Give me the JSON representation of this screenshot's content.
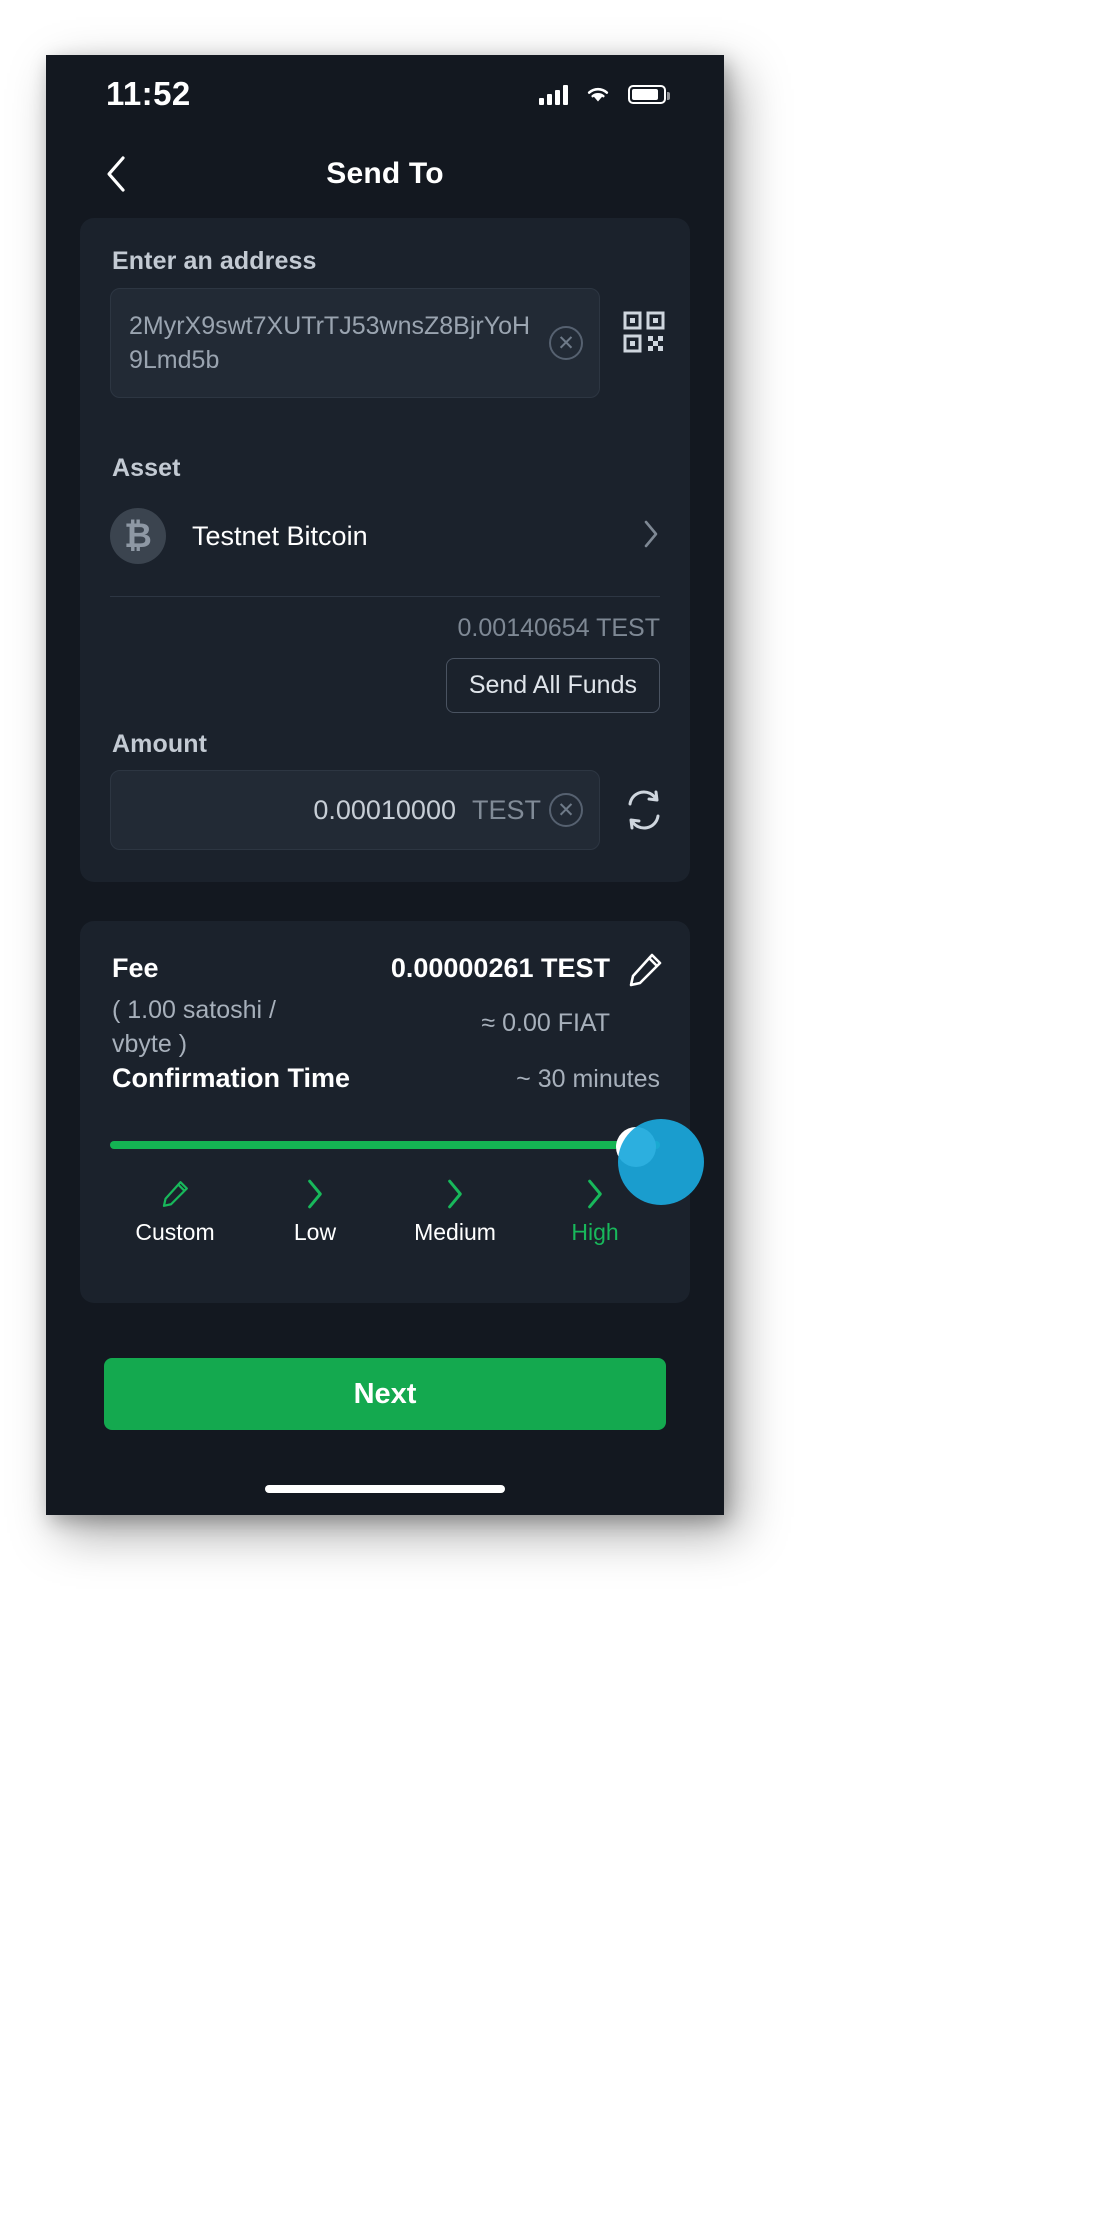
{
  "status_bar": {
    "time": "11:52",
    "signal_icon": "cellular-signal-icon",
    "wifi_icon": "wifi-icon",
    "battery_icon": "battery-icon"
  },
  "header": {
    "title": "Send To",
    "back_icon": "back-chevron-icon"
  },
  "send_card": {
    "address_label": "Enter an address",
    "address_value": "2MyrX9swt7XUTrTJ53wnsZ8BjrYoH9Lmd5b",
    "address_placeholder": "Enter an address",
    "clear_icon": "clear-circle-icon",
    "qr_icon": "qr-code-scan-icon",
    "asset_label": "Asset",
    "asset_symbol": "₿",
    "asset_name": "Testnet Bitcoin",
    "asset_chevron_icon": "chevron-right-icon",
    "balance": "0.00140654 TEST",
    "send_all_label": "Send All Funds",
    "amount_label": "Amount",
    "amount_value": "0.00010000",
    "amount_unit": "TEST",
    "amount_clear_icon": "clear-circle-icon",
    "swap_icon": "swap-currency-icon"
  },
  "fee_card": {
    "fee_label": "Fee",
    "fee_rate": "( 1.00 satoshi / vbyte )",
    "fee_amount": "0.00000261 TEST",
    "fee_fiat": "≈ 0.00 FIAT",
    "edit_icon": "pencil-edit-icon",
    "confirmation_label": "Confirmation Time",
    "confirmation_value": "~ 30 minutes",
    "slider": {
      "selected": "High",
      "position_percent": 100,
      "track_color": "#14b453",
      "thumb_color": "#ffffff",
      "ripple_color": "#1aa8dc"
    },
    "steps": [
      {
        "label": "Custom",
        "icon": "pencil-edit-icon",
        "active": false
      },
      {
        "label": "Low",
        "icon": "chevron-right-icon",
        "active": false
      },
      {
        "label": "Medium",
        "icon": "chevron-right-icon",
        "active": false
      },
      {
        "label": "High",
        "icon": "chevron-right-icon",
        "active": true
      }
    ]
  },
  "footer": {
    "next_label": "Next",
    "accent_color": "#14a94f"
  }
}
